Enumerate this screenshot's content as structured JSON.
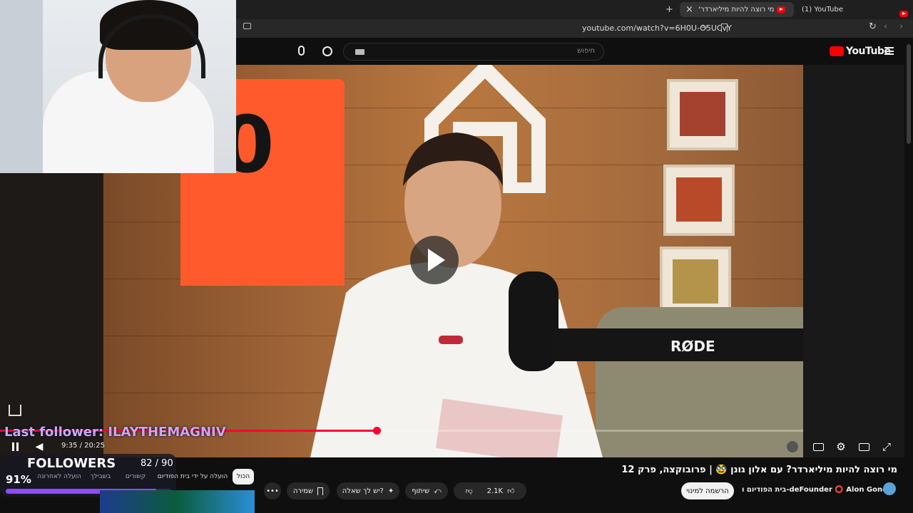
{
  "browser": {
    "tabs": [
      {
        "label": "מי רוצה להיות מיליארדר? עם",
        "active": true
      },
      {
        "label": "(1) YouTube",
        "active": false
      }
    ],
    "new_tab": "+",
    "close": "×",
    "url": "youtube.com/watch?v=6H0U-O5UCvY"
  },
  "youtube": {
    "logo": "YouTube",
    "search_placeholder": "חיפוש"
  },
  "player": {
    "time": "9:35 / 20:25",
    "progress": 0.469,
    "brand_text": "RØDE"
  },
  "overlay": {
    "last_follower": "Last follower: ILAYTHEMAGNIV",
    "followers_title": "FOLLOWERS",
    "followers_count": "82 / 90",
    "followers_pct": "91%",
    "followers_fraction": 0.91
  },
  "video_info": {
    "title": "מי רוצה להיות מיליארדר? עם אלון גונן 🥸 | פרובוקצה, פרק 12",
    "channel": "בית הפודיום ו-deFounder ⭕ Alon Gonen",
    "subscribe": "הרשמה למינוי",
    "likes": "2.1K",
    "share": "שיתוף",
    "ask": "יש לך שאלה?",
    "save": "שמירה",
    "more": "•••"
  },
  "chips": [
    "הכול",
    "הועלה על ידי בית הפודיום",
    "קשורים",
    "בשבילך",
    "הועלה לאחרונה"
  ],
  "colors": {
    "accent": "#ff0033",
    "follower_purple": "#8b4dff"
  }
}
